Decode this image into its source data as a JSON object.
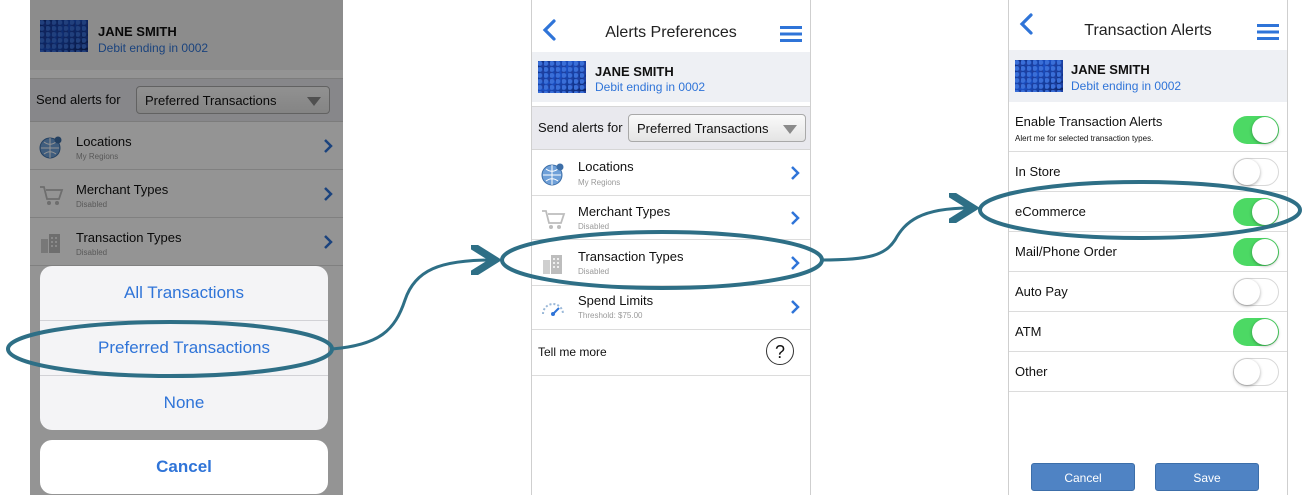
{
  "card": {
    "holder": "JANE SMITH",
    "account": "Debit ending in 0002"
  },
  "send_alerts": {
    "label": "Send alerts for",
    "selected": "Preferred Transactions"
  },
  "menu_items": [
    {
      "title": "Locations",
      "subtitle": "My Regions",
      "icon": "globe-pin-icon"
    },
    {
      "title": "Merchant Types",
      "subtitle": "Disabled",
      "icon": "shopping-cart-icon"
    },
    {
      "title": "Transaction Types",
      "subtitle": "Disabled",
      "icon": "building-icon"
    },
    {
      "title": "Spend Limits",
      "subtitle": "Threshold: $75.00",
      "icon": "gauge-icon"
    }
  ],
  "action_sheet": {
    "options": [
      "All Transactions",
      "Preferred Transactions",
      "None"
    ],
    "cancel": "Cancel"
  },
  "screen2": {
    "title": "Alerts Preferences",
    "tell_me_more": "Tell me more",
    "help_icon": "?"
  },
  "screen3": {
    "title": "Transaction Alerts",
    "enable": {
      "label": "Enable Transaction Alerts",
      "sub": "Alert me for selected transaction types.",
      "on": true
    },
    "toggles": [
      {
        "label": "In Store",
        "on": false
      },
      {
        "label": "eCommerce",
        "on": true
      },
      {
        "label": "Mail/Phone Order",
        "on": true
      },
      {
        "label": "Auto Pay",
        "on": false
      },
      {
        "label": "ATM",
        "on": true
      },
      {
        "label": "Other",
        "on": false
      }
    ],
    "cancel_label": "Cancel",
    "save_label": "Save"
  },
  "colors": {
    "accent": "#2f74d8",
    "toggle_on": "#4cd964",
    "highlight": "#2e6f86",
    "button": "#4f83c4"
  }
}
